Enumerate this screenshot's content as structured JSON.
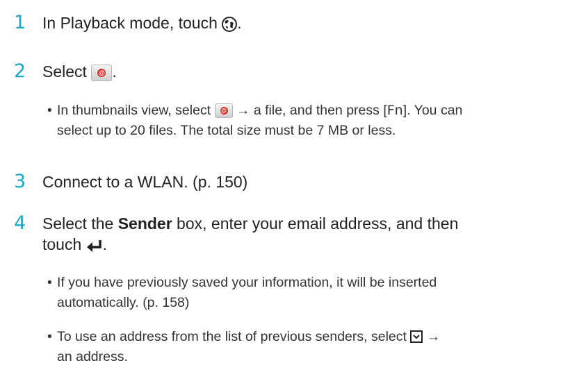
{
  "steps": [
    {
      "num": "1",
      "pre": "In Playback mode, touch ",
      "post": "."
    },
    {
      "num": "2",
      "pre": "Select ",
      "post": "."
    },
    {
      "num": "3",
      "text": "Connect to a WLAN. (p. 150)"
    },
    {
      "num": "4",
      "pre": "Select the ",
      "bold": "Sender",
      "mid": " box, enter your email address, and then",
      "line2_pre": "touch ",
      "post": "."
    }
  ],
  "bullets": {
    "b2": {
      "pre": "In thumbnails view, select ",
      "mid": " → a file, and then press [",
      "key": "Fn",
      "post": "]. You can",
      "line2": "select up to 20 files. The total size must be 7 MB or less."
    },
    "b4a": {
      "line1": "If you have previously saved your information, it will be inserted",
      "line2": "automatically. (p. 158)"
    },
    "b4b": {
      "pre": "To use an address from the list of previous senders, select ",
      "post": " →",
      "line2": "an address."
    }
  },
  "bullet_char": "•",
  "icons": [
    "globe-icon",
    "email-icon",
    "enter-icon",
    "dropdown-icon"
  ],
  "accent_color": "#1aa7c7"
}
